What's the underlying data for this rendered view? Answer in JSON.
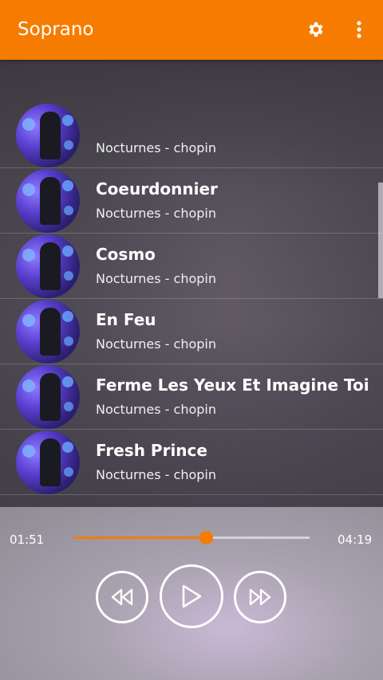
{
  "app": {
    "title": "Soprano"
  },
  "toolbar": {
    "settings_icon": "gear-icon",
    "more_icon": "more-vert-icon"
  },
  "songs": [
    {
      "title": "",
      "subtitle": "Nocturnes - chopin"
    },
    {
      "title": "Coeurdonnier",
      "subtitle": "Nocturnes - chopin"
    },
    {
      "title": "Cosmo",
      "subtitle": "Nocturnes - chopin"
    },
    {
      "title": "En Feu",
      "subtitle": "Nocturnes - chopin"
    },
    {
      "title": "Ferme Les Yeux Et Imagine Toi",
      "subtitle": "Nocturnes - chopin"
    },
    {
      "title": "Fresh Prince",
      "subtitle": "Nocturnes - chopin"
    }
  ],
  "player": {
    "current_time": "01:51",
    "total_time": "04:19",
    "progress": 0.56,
    "prev_icon": "rewind-icon",
    "play_icon": "play-icon",
    "next_icon": "fast-forward-icon"
  },
  "colors": {
    "accent": "#f57c00"
  }
}
